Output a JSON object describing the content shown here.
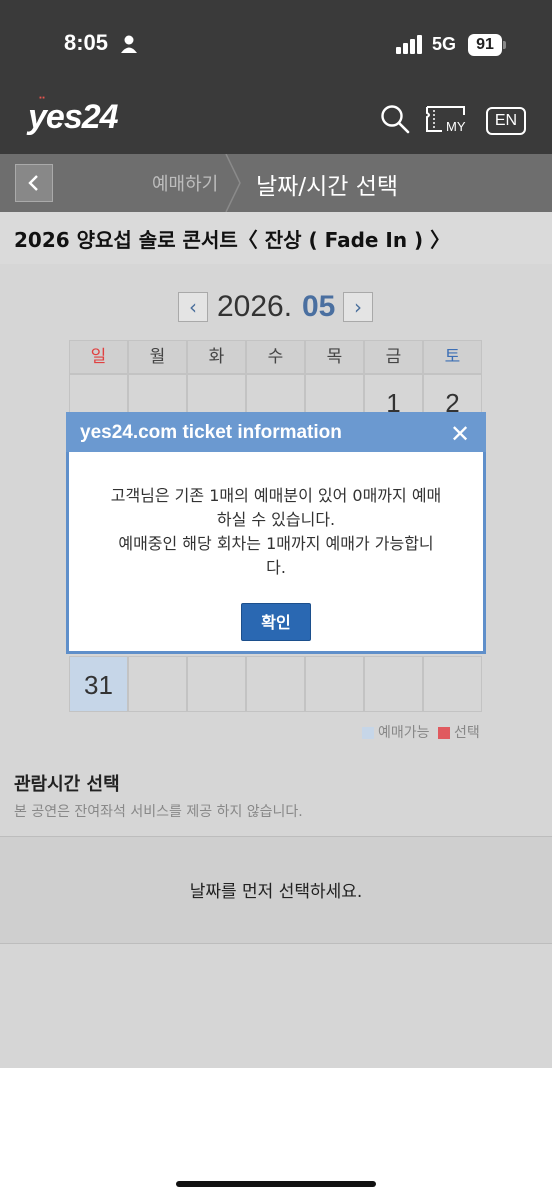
{
  "status_bar": {
    "time": "8:05",
    "network": "5G",
    "battery": "91"
  },
  "header": {
    "logo": "yes24",
    "lang_label": "EN",
    "my_label": "MY"
  },
  "breadcrumb": {
    "prev": "예매하기",
    "current": "날짜/시간 선택"
  },
  "show": {
    "title": "2026 양요섭 솔로 콘서트〈 잔상 ( Fade In ) 〉"
  },
  "calendar": {
    "year_label": "2026.",
    "month_label": "05",
    "weekdays": [
      "일",
      "월",
      "화",
      "수",
      "목",
      "금",
      "토"
    ],
    "visible_days": [
      "1",
      "2",
      "31"
    ]
  },
  "legend": {
    "available": "예매가능",
    "selected": "선택"
  },
  "colors": {
    "available": "#c6d6e8",
    "selected": "#e05a5f",
    "sunday": "#e04040",
    "saturday": "#3d6fb5",
    "accent": "#2a68b2"
  },
  "viewing_time": {
    "heading": "관람시간 선택",
    "note": "본 공연은 잔여좌석 서비스를 제공 하지 않습니다.",
    "placeholder": "날짜를 먼저 선택하세요."
  },
  "modal": {
    "title": "yes24.com ticket information",
    "close": "✕",
    "line1": "고객님은 기존 1매의 예매분이 있어 0매까지 예매",
    "line2": "하실 수 있습니다.",
    "line3": "예매중인 해당 회차는 1매까지 예매가 가능합니",
    "line4": "다.",
    "confirm": "확인"
  }
}
